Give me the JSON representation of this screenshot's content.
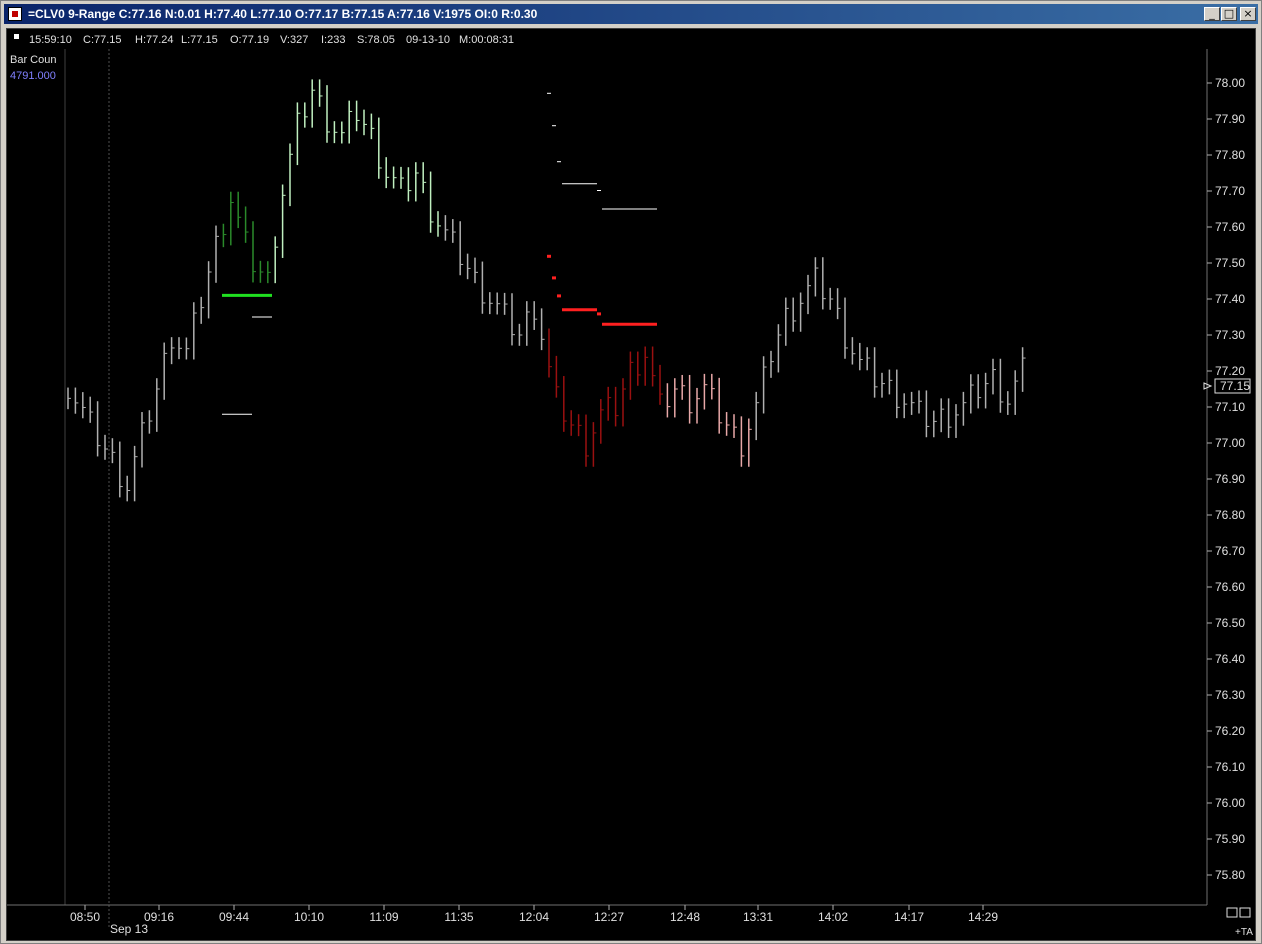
{
  "window": {
    "title": "=CLV0 9-Range C:77.16 N:0.01 H:77.40 L:77.10 O:77.17 B:77.15 A:77.16 V:1975 OI:0 R:0.30",
    "minimize_icon": "minimize-icon",
    "restore_icon": "restore-icon",
    "close_icon": "close-icon"
  },
  "status_bar": {
    "time": "15:59:10",
    "close": "C:77.15",
    "high": "H:77.24",
    "low": "L:77.15",
    "open": "O:77.19",
    "volume": "V:327",
    "index": "I:233",
    "s_value": "S:78.05",
    "date": "09-13-10",
    "m_value": "M:00:08:31"
  },
  "indicator": {
    "label": "Bar Coun",
    "value": "4791.000",
    "value_color": "#8080ff"
  },
  "last_price_label": "77.15",
  "x_date_label": "Sep 13",
  "corner_label": "+TA",
  "colors": {
    "background": "#000000",
    "bars_default": "#b0b0b0",
    "bars_light_green": "#c0f0c0",
    "bars_dark_green": "#2a8a2a",
    "bars_dark_red": "#9a1010",
    "bars_pink": "#e8a8a8",
    "level_green": "#20e020",
    "level_red": "#ff2020",
    "level_white": "#ffffff"
  },
  "chart_data": {
    "type": "line",
    "title": "",
    "xlabel": "",
    "ylabel": "",
    "ylim": [
      75.75,
      78.05
    ],
    "y_ticks": [
      "78.00",
      "77.90",
      "77.80",
      "77.70",
      "77.60",
      "77.50",
      "77.40",
      "77.30",
      "77.20",
      "77.10",
      "77.00",
      "76.90",
      "76.80",
      "76.70",
      "76.60",
      "76.50",
      "76.40",
      "76.30",
      "76.20",
      "76.10",
      "76.00",
      "75.90",
      "75.80"
    ],
    "x_ticks": [
      "08:50",
      "09:16",
      "09:44",
      "10:10",
      "11:09",
      "11:35",
      "12:04",
      "12:27",
      "12:48",
      "13:31",
      "14:02",
      "14:17",
      "14:29"
    ],
    "price_path": [
      [
        0,
        77.16
      ],
      [
        3,
        77.05
      ],
      [
        6,
        76.95
      ],
      [
        8,
        76.88
      ],
      [
        10,
        77.02
      ],
      [
        12,
        77.15
      ],
      [
        14,
        77.3
      ],
      [
        16,
        77.25
      ],
      [
        18,
        77.4
      ],
      [
        20,
        77.55
      ],
      [
        22,
        77.68
      ],
      [
        24,
        77.55
      ],
      [
        25,
        77.5
      ],
      [
        27,
        77.45
      ],
      [
        28,
        77.58
      ],
      [
        29,
        77.7
      ],
      [
        31,
        77.88
      ],
      [
        33,
        77.98
      ],
      [
        35,
        77.9
      ],
      [
        37,
        77.85
      ],
      [
        39,
        77.92
      ],
      [
        41,
        77.85
      ],
      [
        43,
        77.75
      ],
      [
        45,
        77.7
      ],
      [
        47,
        77.75
      ],
      [
        49,
        77.65
      ],
      [
        51,
        77.58
      ],
      [
        53,
        77.52
      ],
      [
        55,
        77.45
      ],
      [
        57,
        77.4
      ],
      [
        59,
        77.35
      ],
      [
        61,
        77.3
      ],
      [
        63,
        77.38
      ],
      [
        64,
        77.3
      ],
      [
        65,
        77.2
      ],
      [
        66,
        77.12
      ],
      [
        68,
        77.05
      ],
      [
        70,
        77.0
      ],
      [
        72,
        77.08
      ],
      [
        74,
        77.1
      ],
      [
        76,
        77.2
      ],
      [
        78,
        77.25
      ],
      [
        80,
        77.1
      ],
      [
        82,
        77.15
      ],
      [
        84,
        77.12
      ],
      [
        86,
        77.15
      ],
      [
        88,
        77.08
      ],
      [
        90,
        77.02
      ],
      [
        91,
        77.0
      ],
      [
        93,
        77.1
      ],
      [
        95,
        77.25
      ],
      [
        97,
        77.35
      ],
      [
        99,
        77.4
      ],
      [
        101,
        77.45
      ],
      [
        103,
        77.4
      ],
      [
        105,
        77.3
      ],
      [
        107,
        77.22
      ],
      [
        109,
        77.18
      ],
      [
        111,
        77.15
      ],
      [
        113,
        77.12
      ],
      [
        115,
        77.08
      ],
      [
        117,
        77.06
      ],
      [
        119,
        77.08
      ],
      [
        121,
        77.1
      ],
      [
        123,
        77.15
      ],
      [
        125,
        77.18
      ],
      [
        127,
        77.12
      ],
      [
        129,
        77.2
      ]
    ],
    "levels": [
      {
        "color": "green",
        "price": 77.41
      },
      {
        "color": "red",
        "price": 77.37
      },
      {
        "color": "red",
        "price": 77.33
      },
      {
        "color": "white",
        "price": 77.72
      },
      {
        "color": "white",
        "price": 77.65
      },
      {
        "color": "white",
        "price": 77.35
      },
      {
        "color": "white",
        "price": 77.08
      }
    ],
    "last_price": 77.15
  }
}
